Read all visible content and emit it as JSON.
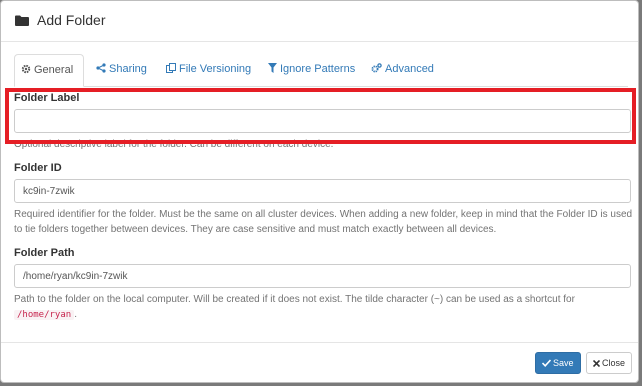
{
  "modal": {
    "title": "Add Folder"
  },
  "tabs": [
    {
      "label": "General",
      "icon": "gear-icon",
      "active": true
    },
    {
      "label": "Sharing",
      "icon": "share-icon"
    },
    {
      "label": "File Versioning",
      "icon": "copy-icon"
    },
    {
      "label": "Ignore Patterns",
      "icon": "filter-icon"
    },
    {
      "label": "Advanced",
      "icon": "cogs-icon"
    }
  ],
  "fields": {
    "folder_label": {
      "label": "Folder Label",
      "value": "",
      "help": "Optional descriptive label for the folder. Can be different on each device."
    },
    "folder_id": {
      "label": "Folder ID",
      "value": "kc9in-7zwik",
      "help": "Required identifier for the folder. Must be the same on all cluster devices. When adding a new folder, keep in mind that the Folder ID is used to tie folders together between devices. They are case sensitive and must match exactly between all devices."
    },
    "folder_path": {
      "label": "Folder Path",
      "value": "/home/ryan/kc9in-7zwik",
      "help_prefix": "Path to the folder on the local computer. Will be created if it does not exist. The tilde character (~) can be used as a shortcut for",
      "help_code": "/home/ryan",
      "help_suffix": "."
    }
  },
  "footer": {
    "save_label": "Save",
    "close_label": "Close"
  },
  "colors": {
    "primary": "#337ab7",
    "highlight": "#e51e25",
    "code": "#c7254e"
  }
}
